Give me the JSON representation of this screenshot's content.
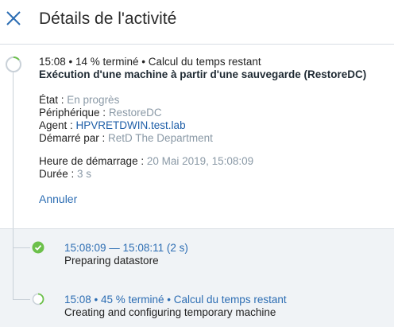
{
  "header": {
    "title": "Détails de l'activité"
  },
  "activity": {
    "status_line": "15:08 • 14 % terminé • Calcul du temps restant",
    "name": "Exécution d'une machine à partir d'une sauvegarde (RestoreDC)",
    "progress_percent": 14,
    "details": {
      "state_label": "État : ",
      "state_value": "En progrès",
      "device_label": "Périphérique : ",
      "device_value": "RestoreDC",
      "agent_label": "Agent : ",
      "agent_value": "HPVRETDWIN.test.lab",
      "started_by_label": "Démarré par : ",
      "started_by_value": "RetD The Department",
      "start_time_label": "Heure de démarrage : ",
      "start_time_value": "20 Mai 2019, 15:08:09",
      "duration_label": "Durée : ",
      "duration_value": "3 s"
    },
    "cancel_label": "Annuler"
  },
  "children": [
    {
      "meta": "15:08:09 — 15:08:11 (2 s)",
      "name": "Preparing datastore",
      "status": "done"
    },
    {
      "meta": "15:08 • 45 % terminé • Calcul du temps restant",
      "name": "Creating and configuring temporary machine",
      "status": "in-progress",
      "progress_percent": 45
    }
  ],
  "colors": {
    "accent": "#2c6db3",
    "success": "#6cc04a",
    "muted": "#8a99a6"
  }
}
